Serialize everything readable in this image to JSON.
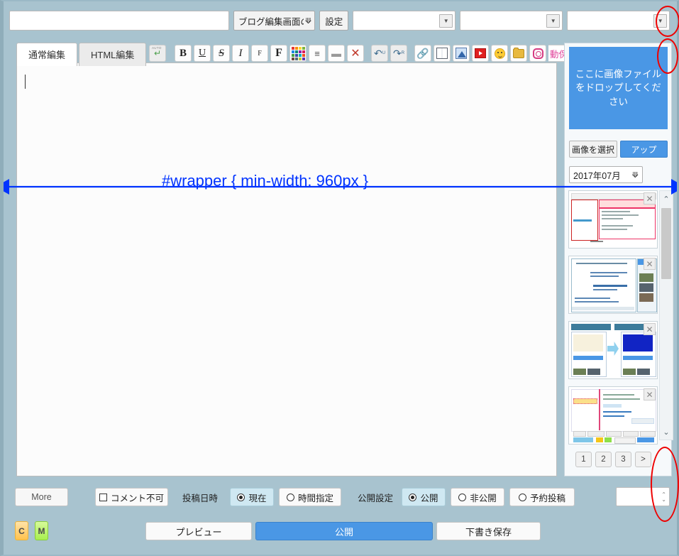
{
  "topbar": {
    "title_value": "",
    "title_placeholder": "",
    "category_select": "ブログ編集画面の…",
    "chevron": "❯",
    "setting_button": "設定",
    "empty_select_1": "",
    "empty_select_2": "",
    "empty_select_3": "",
    "dropdown_arrow": "▼"
  },
  "editor": {
    "tabs": [
      {
        "label": "通常編集",
        "active": true
      },
      {
        "label": "HTML編集",
        "active": false
      }
    ],
    "body_text": "",
    "toolbar": [
      {
        "name": "auto-return-icon",
        "label": "AUTO"
      },
      {
        "name": "bold-icon",
        "label": "B"
      },
      {
        "name": "underline-icon",
        "label": "U"
      },
      {
        "name": "strikethrough-icon",
        "label": "S"
      },
      {
        "name": "italic-icon",
        "label": "I"
      },
      {
        "name": "font-size-small-icon",
        "label": "F"
      },
      {
        "name": "font-size-large-icon",
        "label": "F"
      },
      {
        "name": "color-palette-icon",
        "label": ""
      },
      {
        "name": "align-icon",
        "label": "≡"
      },
      {
        "name": "horizontal-rule-icon",
        "label": "▬"
      },
      {
        "name": "clear-format-icon",
        "label": "✕"
      },
      {
        "name": "undo-icon",
        "label": "↶"
      },
      {
        "name": "redo-icon",
        "label": "↷"
      },
      {
        "name": "link-icon",
        "label": "🔗"
      },
      {
        "name": "book-icon",
        "label": ""
      },
      {
        "name": "image-icon",
        "label": ""
      },
      {
        "name": "video-icon",
        "label": ""
      },
      {
        "name": "emoji-icon",
        "label": ""
      },
      {
        "name": "folder-icon",
        "label": ""
      },
      {
        "name": "instagram-icon",
        "label": ""
      }
    ],
    "autosave_label": "動保存",
    "palette_colors": [
      "#e53935",
      "#fb8c00",
      "#fdd835",
      "#7cb342",
      "#1e88e5",
      "#00897b",
      "#8e24aa",
      "#d81b60",
      "#43a047",
      "#3949ab",
      "#00acc1",
      "#f4511e",
      "#6d4c41",
      "#546e7a",
      "#c0ca33",
      "#5e35b1"
    ]
  },
  "right_panel": {
    "dropzone_text": "ここに画像ファイルをドロップしてください",
    "select_image_button": "画像を選択",
    "upload_button": "アップ",
    "month_select": "2017年07月",
    "month_chevron": "❯",
    "thumbnails": [
      {
        "close_label": "✕"
      },
      {
        "close_label": "✕"
      },
      {
        "close_label": "✕"
      },
      {
        "close_label": "✕"
      }
    ],
    "scroll_up": "⌃",
    "scroll_down": "⌄",
    "pager": [
      "1",
      "2",
      "3",
      ">"
    ]
  },
  "options": {
    "more_button": "More",
    "comment_disable": "コメント不可",
    "post_datetime_label": "投稿日時",
    "datetime_options": [
      {
        "label": "現在",
        "selected": true
      },
      {
        "label": "時間指定",
        "selected": false
      }
    ],
    "publish_label": "公開設定",
    "publish_options": [
      {
        "label": "公開",
        "selected": true
      },
      {
        "label": "非公開",
        "selected": false
      },
      {
        "label": "予約投稿",
        "selected": false
      }
    ],
    "spinner_value": "",
    "spinner_up": "⌃",
    "spinner_down": "⌄"
  },
  "footer": {
    "badges": [
      {
        "label": "C",
        "color": "#ffc24d"
      },
      {
        "label": "M",
        "color": "#a8ef4e"
      }
    ],
    "preview_button": "プレビュー",
    "publish_button": "公開",
    "draft_button": "下書き保存"
  },
  "annotation": {
    "wrapper_text": "#wrapper { min-width: 960px }",
    "arrow_color": "#0033ff",
    "highlight_color": "#ee0000"
  }
}
